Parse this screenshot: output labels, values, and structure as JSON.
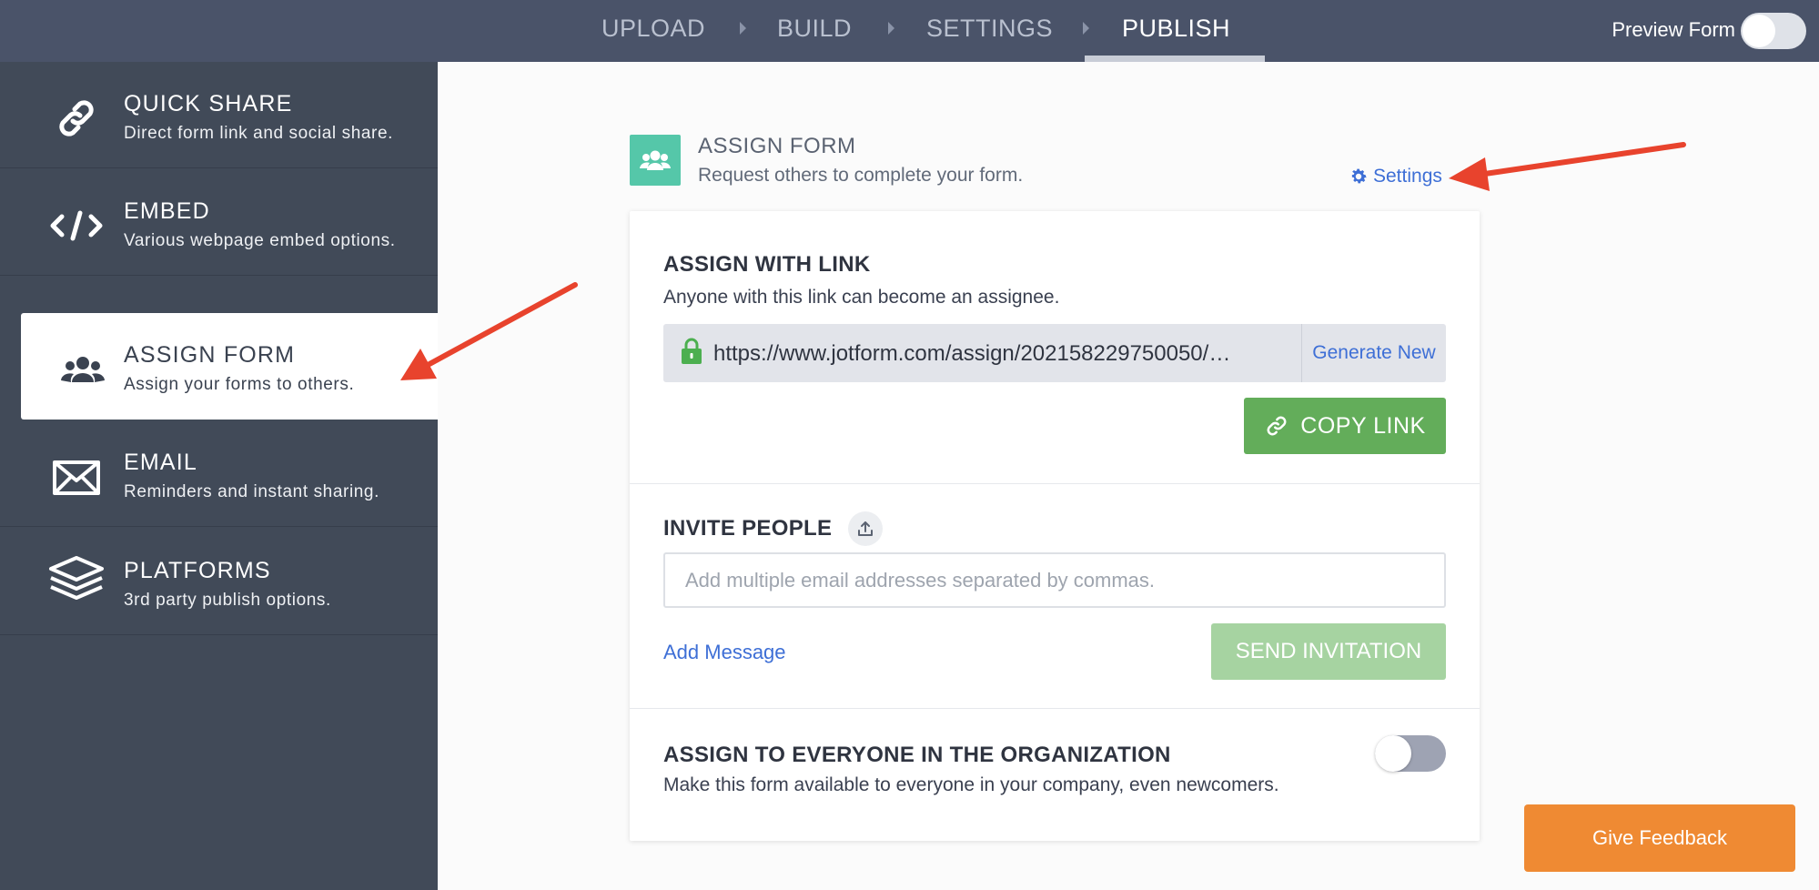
{
  "topbar": {
    "steps": [
      "UPLOAD",
      "BUILD",
      "SETTINGS",
      "PUBLISH"
    ],
    "active_step": "PUBLISH",
    "preview_label": "Preview Form",
    "preview_enabled": false
  },
  "sidebar": {
    "items": [
      {
        "title": "QUICK SHARE",
        "subtitle": "Direct form link and social share.",
        "icon": "link-icon"
      },
      {
        "title": "EMBED",
        "subtitle": "Various webpage embed options.",
        "icon": "code-icon"
      },
      {
        "title": "ASSIGN FORM",
        "subtitle": "Assign your forms to others.",
        "icon": "users-icon",
        "active": true
      },
      {
        "title": "EMAIL",
        "subtitle": "Reminders and instant sharing.",
        "icon": "envelope-icon"
      },
      {
        "title": "PLATFORMS",
        "subtitle": "3rd party publish options.",
        "icon": "layers-icon"
      }
    ]
  },
  "header": {
    "title": "ASSIGN FORM",
    "subtitle": "Request others to complete your form.",
    "settings_label": "Settings"
  },
  "assign_link": {
    "title": "ASSIGN WITH LINK",
    "description": "Anyone with this link can become an assignee.",
    "url": "https://www.jotform.com/assign/202158229750050/…",
    "generate_label": "Generate New",
    "copy_label": "COPY LINK"
  },
  "invite": {
    "title": "INVITE PEOPLE",
    "placeholder": "Add multiple email addresses separated by commas.",
    "add_message_label": "Add Message",
    "send_label": "SEND INVITATION"
  },
  "organization": {
    "title": "ASSIGN TO EVERYONE IN THE ORGANIZATION",
    "description": "Make this form available to everyone in your company, even newcomers.",
    "enabled": false
  },
  "feedback_label": "Give Feedback",
  "colors": {
    "topbar": "#4a5369",
    "sidebar": "#414a58",
    "accent_green": "#63ad5a",
    "link_blue": "#3e6fd6",
    "feedback_orange": "#ef8a33",
    "annotation_red": "#e8432d"
  }
}
